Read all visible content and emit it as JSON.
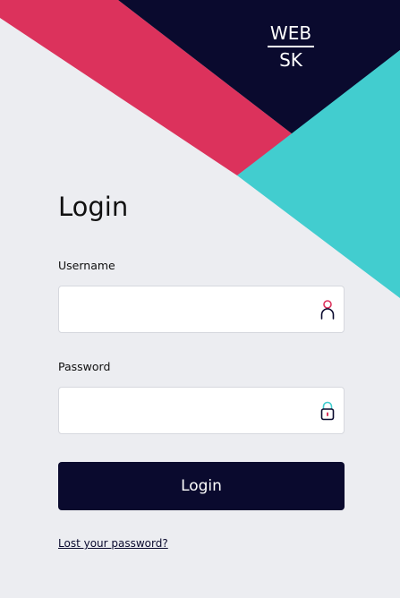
{
  "logo": {
    "line1": "WEB",
    "line2": "SK"
  },
  "form": {
    "title": "Login",
    "username": {
      "label": "Username",
      "value": "",
      "icon": "user-icon"
    },
    "password": {
      "label": "Password",
      "value": "",
      "icon": "lock-icon"
    },
    "submit_label": "Login",
    "lost_password_label": "Lost your password?"
  },
  "colors": {
    "background": "#ECEDF1",
    "navy": "#0A0A2E",
    "pink": "#DC325C",
    "teal": "#42CDCF",
    "white": "#FFFFFF"
  }
}
